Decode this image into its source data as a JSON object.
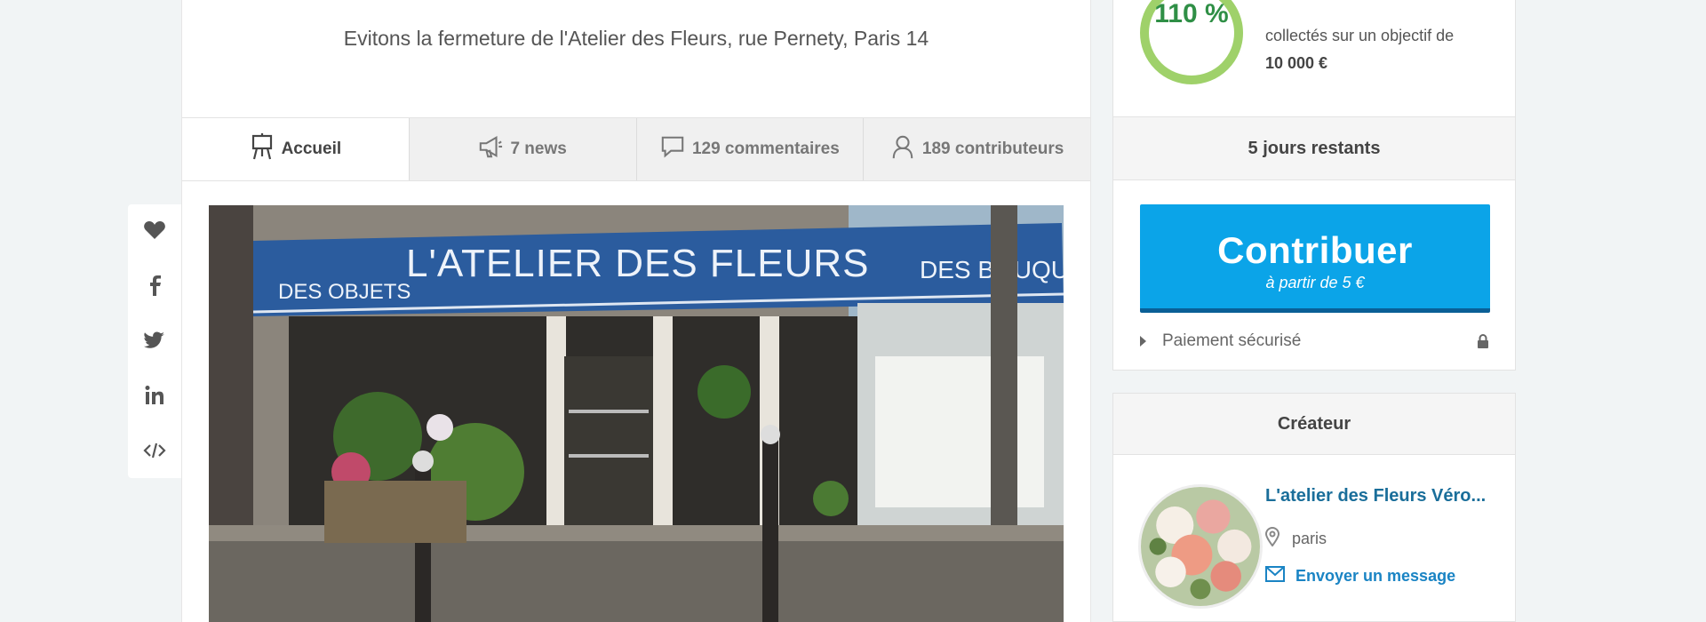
{
  "project": {
    "subtitle": "Evitons la fermeture de l'Atelier des Fleurs, rue Pernety, Paris 14",
    "hero_sign": "L'ATELIER DES FLEURS",
    "hero_sign_left": "DES OBJETS",
    "hero_sign_right": "DES BOUQUETS"
  },
  "tabs": [
    {
      "label": "Accueil",
      "icon": "easel-icon"
    },
    {
      "label": "7 news",
      "icon": "megaphone-icon"
    },
    {
      "label": "129 commentaires",
      "icon": "comment-icon"
    },
    {
      "label": "189 contributeurs",
      "icon": "user-icon"
    }
  ],
  "share": [
    "heart-icon",
    "facebook-icon",
    "twitter-icon",
    "linkedin-icon",
    "embed-icon"
  ],
  "funding": {
    "percent": "110 %",
    "collected_text": "collectés sur un objectif de",
    "goal": "10 000 €",
    "days_left": "5 jours restants",
    "cta_label": "Contribuer",
    "cta_sub": "à partir de 5 €",
    "secure_label": "Paiement sécurisé",
    "ring_color": "#9fd16a",
    "cta_color": "#0ba4e8"
  },
  "creator": {
    "heading": "Créateur",
    "name": "L'atelier des Fleurs Véro...",
    "location": "paris",
    "message_link": "Envoyer un message"
  }
}
